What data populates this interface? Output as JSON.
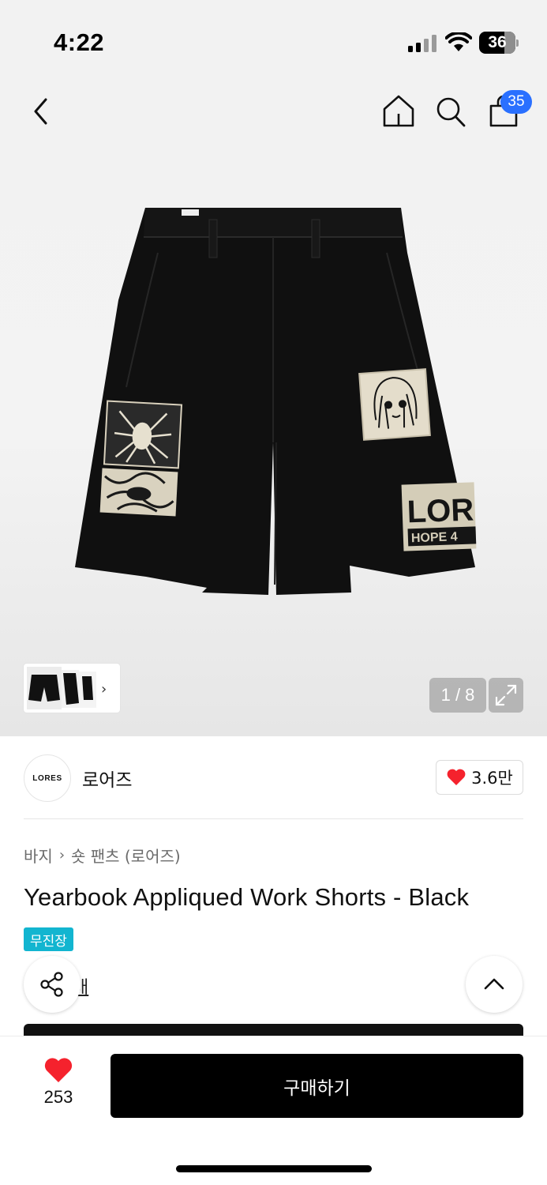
{
  "status_bar": {
    "time": "4:22",
    "battery": "36"
  },
  "header": {
    "cart_count": "35"
  },
  "gallery": {
    "counter": "1 / 8"
  },
  "brand": {
    "logo_text": "LORES",
    "name": "로어즈",
    "like_count": "3.6만"
  },
  "product": {
    "breadcrumb": [
      "바지",
      "숏 팬츠 (로어즈)"
    ],
    "title": "Yearbook Appliqued Work Shorts - Black",
    "tag": "무진장",
    "partial_text": "매"
  },
  "bottom": {
    "like_count": "253",
    "buy_label": "구매하기"
  },
  "colors": {
    "accent_blue": "#2a70ff",
    "tag_cyan": "#12b5d0",
    "heart_red": "#f5222d"
  }
}
